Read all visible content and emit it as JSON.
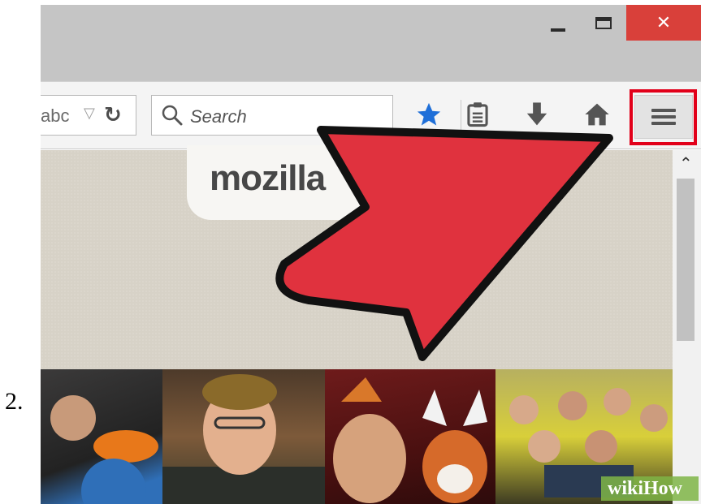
{
  "step": {
    "number": "2."
  },
  "window": {
    "minimize_icon": "minimize-icon",
    "maximize_icon": "maximize-icon",
    "close_icon": "close-icon",
    "close_color": "#d9403a"
  },
  "toolbar": {
    "url_text": "abc",
    "search_placeholder": "Search",
    "icons": [
      "star-icon",
      "clipboard-icon",
      "download-icon",
      "home-icon",
      "hamburger-menu-icon"
    ],
    "star_color": "#1f6fd8",
    "highlight_color": "#e2001a"
  },
  "content": {
    "logo_text": "mozilla"
  },
  "watermark": {
    "text": "wikiHow"
  },
  "annotation": {
    "arrow_color": "#e0323e"
  }
}
